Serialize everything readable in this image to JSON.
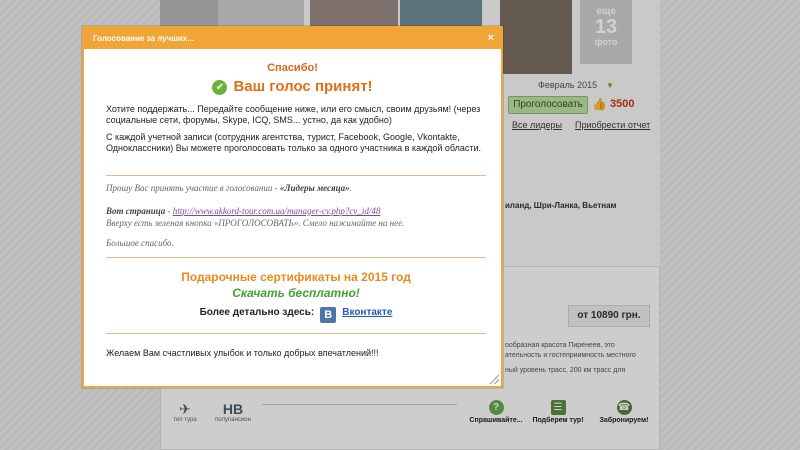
{
  "background": {
    "more_photos": {
      "top": "еще",
      "count": "13",
      "bottom": "фото"
    },
    "month": "Февраль 2015",
    "vote_button": "Проголосовать",
    "vote_count": "3500",
    "links": {
      "leaders": "Все лидеры",
      "report": "Приобрести отчет"
    },
    "countries": "иланд, Шри-Ланка, Вьетнам",
    "price": "от 10890 грн.",
    "desc_lines": [
      "ообразная  красота  Пиренеев,  это",
      "ательность и гостеприимность местного",
      "ный уровень трасс, 200 км трасс для"
    ],
    "tour_type_caption": "тип тура",
    "board_code": "HB",
    "board_caption": "полупансион",
    "actions": {
      "ask": "Спрашивайте...",
      "pick": "Подберем тур!",
      "book": "Забронируем!"
    }
  },
  "dialog": {
    "title": "Голосование за лучших...",
    "close_symbol": "×",
    "thanks": "Спасибо!",
    "accepted": "Ваш голос принят!",
    "paragraph1": "Хотите поддержать... Передайте сообщение ниже, или его смысл, своим друзьям! (через социальные сети, форумы, Skype, ICQ, SMS... устно, да как удобно)",
    "paragraph2": "С каждой учетной записи (сотрудник агентства, турист, Facebook, Google, Vkontakte, Одноклассники) Вы можете проголосовать только за одного участника в каждой области.",
    "msg_line1_prefix": "Прошу Вас принять участие в голосовании - ",
    "msg_line1_bold": "«Лидеры месяца»",
    "msg_line1_suffix": ".",
    "msg_line2_bold": "Вот страница",
    "msg_line2_dash": " - ",
    "msg_link": "http://www.akkord-tour.com.ua/manager-cv.php?cv_id/48",
    "msg_line3": "Вверху есть зеленая кнопка «ПРОГОЛОСОВАТЬ». Смело нажимайте на нее.",
    "msg_line4": "Большое спасибо.",
    "gift_title": "Подарочные сертификаты на 2015 год",
    "gift_download": "Скачать бесплатно!",
    "more_label": "Более детально здесь:",
    "vk_icon_letter": "B",
    "vk_link": "Вконтакте",
    "wish": "Желаем Вам счастливых улыбок и только добрых впечатлений!!!",
    "icons": [
      "check-icon",
      "vkontakte-icon",
      "close-icon"
    ],
    "colors": {
      "header": "#f0a536",
      "accepted": "#e07016",
      "download": "#3fa332"
    }
  }
}
